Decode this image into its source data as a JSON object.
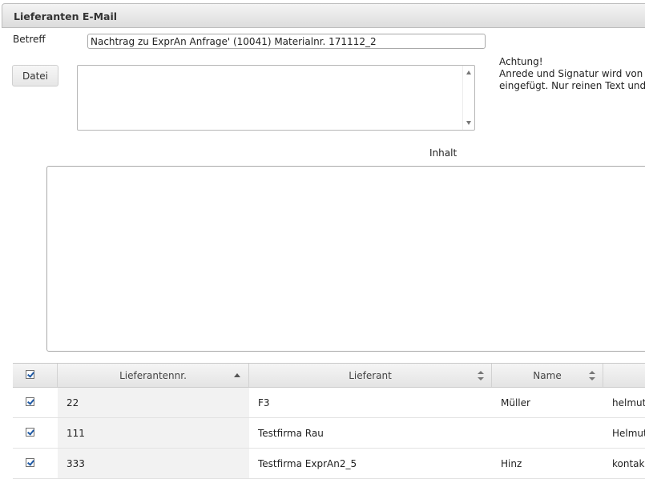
{
  "window": {
    "title": "Lieferanten E-Mail"
  },
  "form": {
    "subject_label": "Betreff",
    "subject_value": "Nachtrag zu ExprAn Anfrage' (10041) Materialnr. 171112_2",
    "file_button_label": "Datei",
    "notice_line1": "Achtung!",
    "notice_line2": "Anrede und Signatur wird von",
    "notice_line3": "eingefügt. Nur reinen Text und",
    "content_label": "Inhalt"
  },
  "grid": {
    "columns": [
      {
        "label": "",
        "sort": "none"
      },
      {
        "label": "Lieferantennr.",
        "sort": "asc"
      },
      {
        "label": "Lieferant",
        "sort": "both"
      },
      {
        "label": "Name",
        "sort": "both"
      },
      {
        "label": "",
        "sort": "none"
      }
    ],
    "rows": [
      {
        "checked": true,
        "nr": "22",
        "lieferant": "F3",
        "name": "Müller",
        "email": "helmut"
      },
      {
        "checked": true,
        "nr": "111",
        "lieferant": "Testfirma Rau",
        "name": "",
        "email": "Helmut"
      },
      {
        "checked": true,
        "nr": "333",
        "lieferant": "Testfirma ExprAn2_5",
        "name": "Hinz",
        "email": "kontak"
      }
    ]
  },
  "colors": {
    "checkmark": "#1f5aa6",
    "titlebar": "#dcdcdc"
  }
}
